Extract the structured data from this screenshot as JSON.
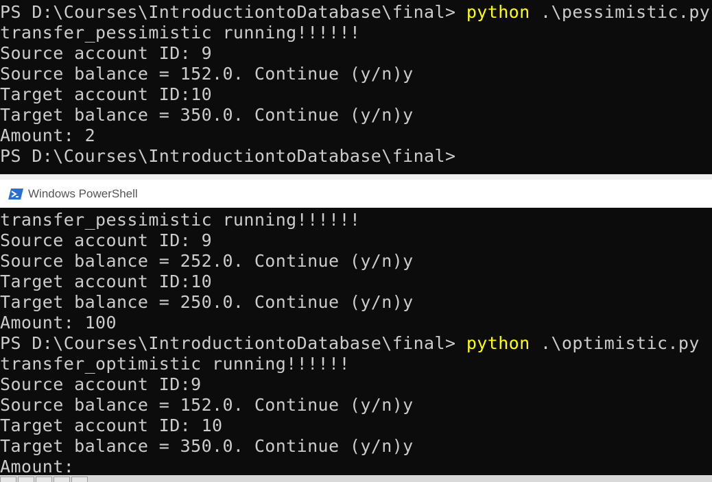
{
  "terminal_top": {
    "lines": [
      {
        "prompt": "PS D:\\Courses\\IntroductiontoDatabase\\final> ",
        "command": "python",
        "args": " .\\pessimistic.py"
      },
      {
        "text": "transfer_pessimistic running!!!!!!"
      },
      {
        "text": "Source account ID: 9"
      },
      {
        "text": "Source balance = 152.0. Continue (y/n)y"
      },
      {
        "text": "Target account ID:10"
      },
      {
        "text": "Target balance = 350.0. Continue (y/n)y"
      },
      {
        "text": "Amount: 2"
      },
      {
        "text": "PS D:\\Courses\\IntroductiontoDatabase\\final>"
      }
    ]
  },
  "window": {
    "title": "Windows PowerShell",
    "icon": "powershell-icon",
    "icon_color": "#2b6fce"
  },
  "terminal_bottom": {
    "lines": [
      {
        "text": "transfer_pessimistic running!!!!!!"
      },
      {
        "text": "Source account ID: 9"
      },
      {
        "text": "Source balance = 252.0. Continue (y/n)y"
      },
      {
        "text": "Target account ID:10"
      },
      {
        "text": "Target balance = 250.0. Continue (y/n)y"
      },
      {
        "text": "Amount: 100"
      },
      {
        "prompt": "PS D:\\Courses\\IntroductiontoDatabase\\final> ",
        "command": "python",
        "args": " .\\optimistic.py"
      },
      {
        "text": "transfer_optimistic running!!!!!!"
      },
      {
        "text": "Source account ID:9"
      },
      {
        "text": "Source balance = 152.0. Continue (y/n)y"
      },
      {
        "text": "Target account ID: 10"
      },
      {
        "text": "Target balance = 350.0. Continue (y/n)y"
      },
      {
        "text": "Amount:"
      }
    ]
  },
  "colors": {
    "terminal_bg": "#0c0c0c",
    "terminal_fg": "#cccccc",
    "command_fg": "#ffff00"
  }
}
